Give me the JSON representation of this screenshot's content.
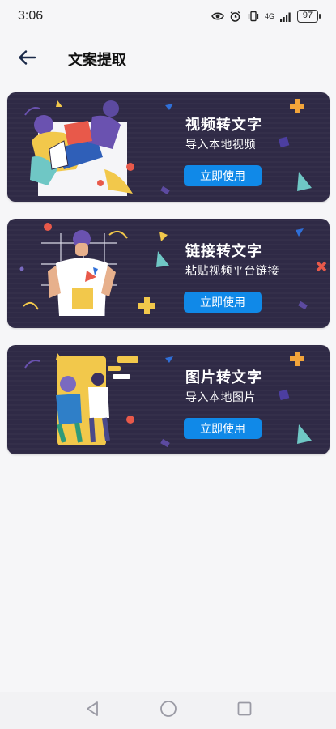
{
  "status_bar": {
    "time": "3:06",
    "network": "4G",
    "battery": "97"
  },
  "header": {
    "title": "文案提取"
  },
  "cards": [
    {
      "title": "视频转文字",
      "subtitle": "导入本地视频",
      "button": "立即使用"
    },
    {
      "title": "链接转文字",
      "subtitle": "粘贴视频平台链接",
      "button": "立即使用"
    },
    {
      "title": "图片转文字",
      "subtitle": "导入本地图片",
      "button": "立即使用"
    }
  ],
  "colors": {
    "card_bg": "#2f2a46",
    "button_bg": "#1089e8",
    "accent_yellow": "#f2c84b",
    "accent_red": "#e8594a",
    "accent_teal": "#6fc7c5",
    "accent_purple": "#6a52b0"
  }
}
